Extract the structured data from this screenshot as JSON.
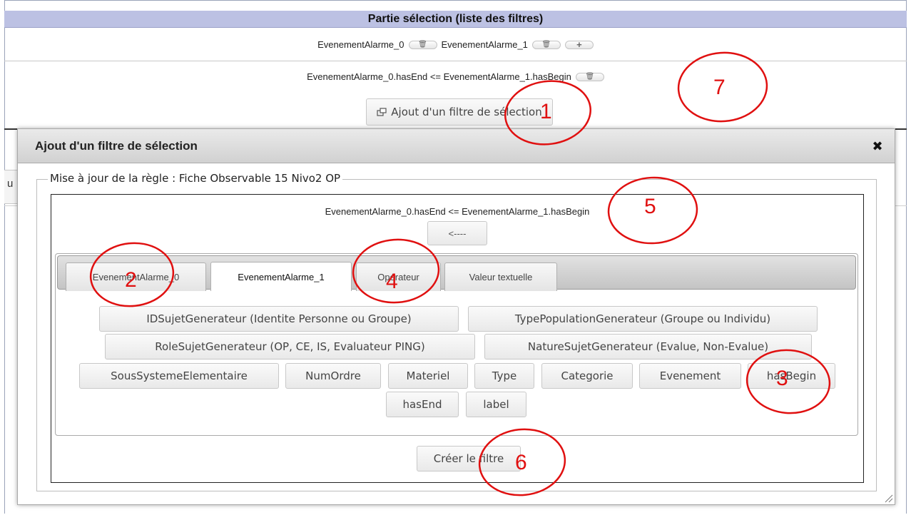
{
  "background": {
    "header_title": "Partie sélection (liste des filtres)",
    "filters": [
      {
        "label": "EvenementAlarme_0"
      },
      {
        "label": "EvenementAlarme_1"
      }
    ],
    "delete_icon_glyph": "🗑",
    "add_icon_glyph": "+",
    "expression": "EvenementAlarme_0.hasEnd <= EvenementAlarme_1.hasBegin",
    "add_filter_button": "Ajout d'un filtre de sélection",
    "add_filter_icon": "window-icon",
    "partial_label": "u"
  },
  "dialog": {
    "title": "Ajout d'un filtre de sélection",
    "close_glyph": "✖",
    "legend": "Mise à jour de la règle : Fiche Observable 15 Nivo2 OP",
    "rule_expression": "EvenementAlarme_0.hasEnd <= EvenementAlarme_1.hasBegin",
    "back_button": "<----",
    "tabs": [
      {
        "label": "EvenementAlarme_0",
        "active": false
      },
      {
        "label": "EvenementAlarme_1",
        "active": true
      },
      {
        "label": "Opérateur",
        "active": false
      },
      {
        "label": "Valeur textuelle",
        "active": false
      }
    ],
    "values": [
      "IDSujetGenerateur (Identite Personne ou Groupe)",
      "TypePopulationGenerateur (Groupe ou Individu)",
      "RoleSujetGenerateur (OP, CE, IS, Evaluateur PING)",
      "NatureSujetGenerateur (Evalue, Non-Evalue)",
      "SousSystemeElementaire",
      "NumOrdre",
      "Materiel",
      "Type",
      "Categorie",
      "Evenement",
      "hasBegin",
      "hasEnd",
      "label"
    ],
    "create_button": "Créer le filtre"
  },
  "annotations": [
    "1",
    "2",
    "3",
    "4",
    "5",
    "6",
    "7"
  ],
  "colors": {
    "header_bg": "#bcc1e3",
    "annotation_red": "#e01010"
  }
}
